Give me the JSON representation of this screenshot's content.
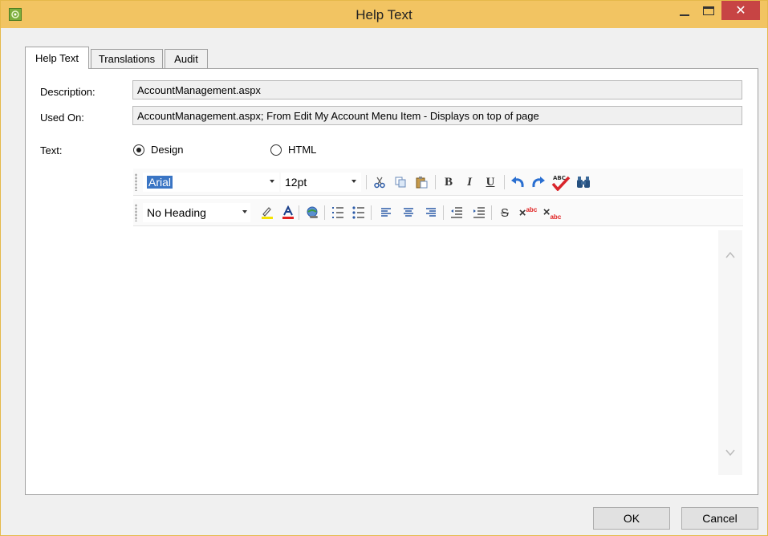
{
  "window": {
    "title": "Help Text",
    "app_icon": "app-icon",
    "controls": {
      "minimize_icon": "minimize-icon",
      "maximize_icon": "maximize-icon",
      "close_glyph": "✕"
    }
  },
  "tabs": [
    {
      "label": "Help Text",
      "active": true
    },
    {
      "label": "Translations",
      "active": false
    },
    {
      "label": "Audit",
      "active": false
    }
  ],
  "form": {
    "description": {
      "label": "Description:",
      "value": "AccountManagement.aspx"
    },
    "used_on": {
      "label": "Used On:",
      "value": "AccountManagement.aspx; From Edit My Account Menu Item - Displays on top of page"
    },
    "text": {
      "label": "Text:"
    },
    "mode": {
      "options": [
        {
          "label": "Design",
          "selected": true
        },
        {
          "label": "HTML",
          "selected": false
        }
      ]
    }
  },
  "toolbar1": {
    "font": "Arial",
    "size": "12pt",
    "bold_label": "B",
    "italic_label": "I",
    "underline_label": "U",
    "spell_label": "ABC",
    "icons": [
      "cut-icon",
      "copy-icon",
      "paste-icon",
      "bold-icon",
      "italic-icon",
      "underline-icon",
      "undo-icon",
      "redo-icon",
      "spellcheck-icon",
      "find-icon"
    ]
  },
  "toolbar2": {
    "heading": "No Heading",
    "strike_label": "S",
    "superscript_label": "abc",
    "subscript_label": "abc",
    "icons": [
      "highlight-icon",
      "font-color-icon",
      "hyperlink-icon",
      "numbered-list-icon",
      "bullet-list-icon",
      "align-left-icon",
      "align-center-icon",
      "align-right-icon",
      "outdent-icon",
      "indent-icon",
      "strikethrough-icon",
      "superscript-icon",
      "subscript-icon"
    ]
  },
  "colors": {
    "titlebar": "#f2c462",
    "close_button": "#c74444",
    "selection": "#3a75c4",
    "highlight": "#f5e400",
    "font_color": "#e02020",
    "undo_redo": "#2a6fd1",
    "spellcheck": "#d9252b"
  },
  "buttons": {
    "ok": "OK",
    "cancel": "Cancel"
  }
}
